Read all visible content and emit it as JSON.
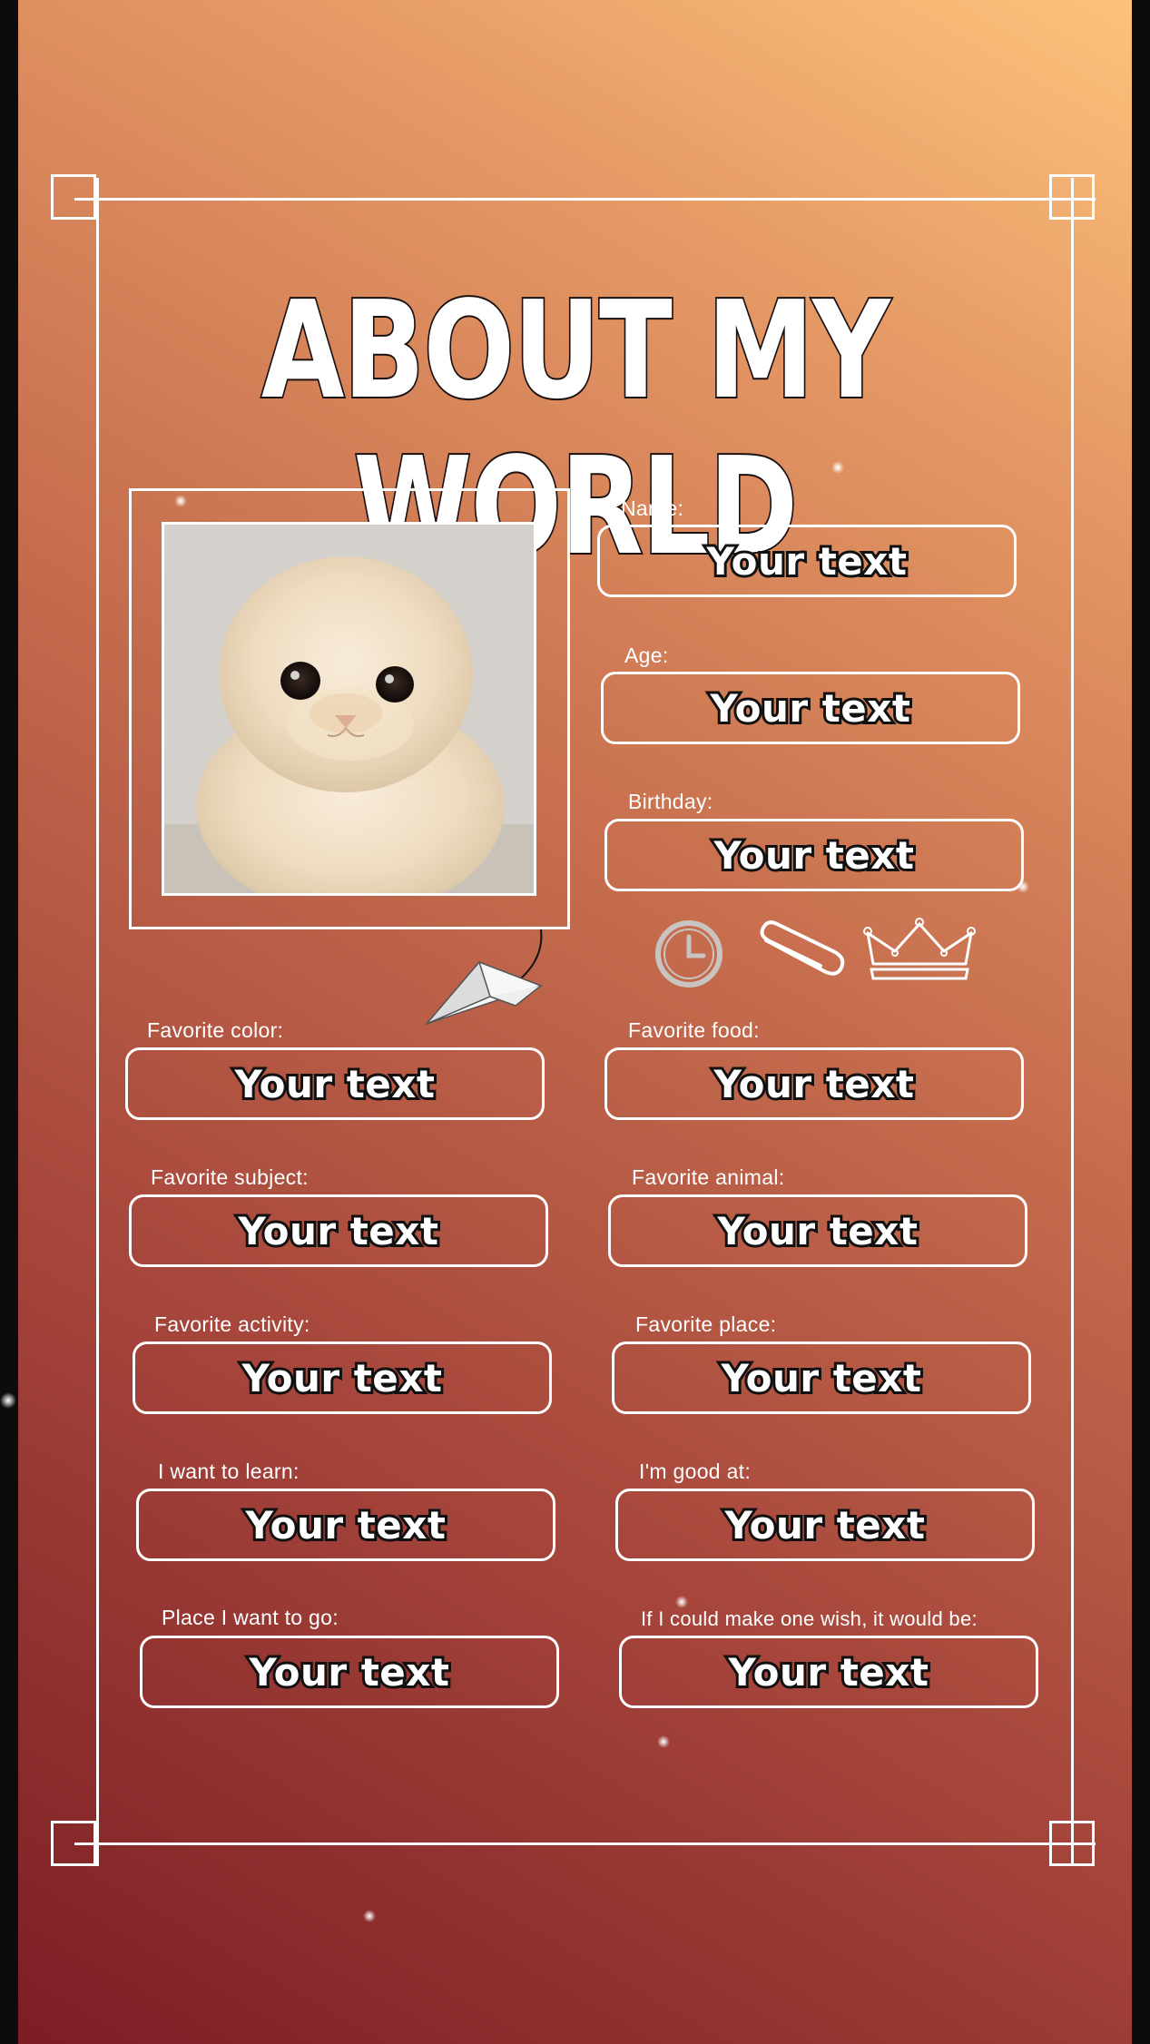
{
  "title": "ABOUT MY WORLD",
  "photo": {
    "subject_icon": "cat-photo"
  },
  "icons": [
    "clock-icon",
    "paperclip-icon",
    "crown-icon",
    "paper-plane-icon"
  ],
  "fields": {
    "name": {
      "label": "Name:",
      "value": "Your text"
    },
    "age": {
      "label": "Age:",
      "value": "Your text"
    },
    "birthday": {
      "label": "Birthday:",
      "value": "Your text"
    },
    "favorite_color": {
      "label": "Favorite color:",
      "value": "Your text"
    },
    "favorite_food": {
      "label": "Favorite food:",
      "value": "Your text"
    },
    "favorite_subject": {
      "label": "Favorite subject:",
      "value": "Your text"
    },
    "favorite_animal": {
      "label": "Favorite animal:",
      "value": "Your text"
    },
    "favorite_activity": {
      "label": "Favorite activity:",
      "value": "Your text"
    },
    "favorite_place": {
      "label": "Favorite place:",
      "value": "Your text"
    },
    "want_to_learn": {
      "label": "I want to learn:",
      "value": "Your text"
    },
    "good_at": {
      "label": "I'm good at:",
      "value": "Your text"
    },
    "place_want_to_go": {
      "label": "Place I want to go:",
      "value": "Your text"
    },
    "one_wish": {
      "label": "If I could make one wish, it would be:",
      "value": "Your text"
    }
  },
  "colors": {
    "gradient_top": "#fdc27c",
    "gradient_bottom": "#7c1d25",
    "outline": "#ffffff",
    "text_stroke": "#111111"
  }
}
